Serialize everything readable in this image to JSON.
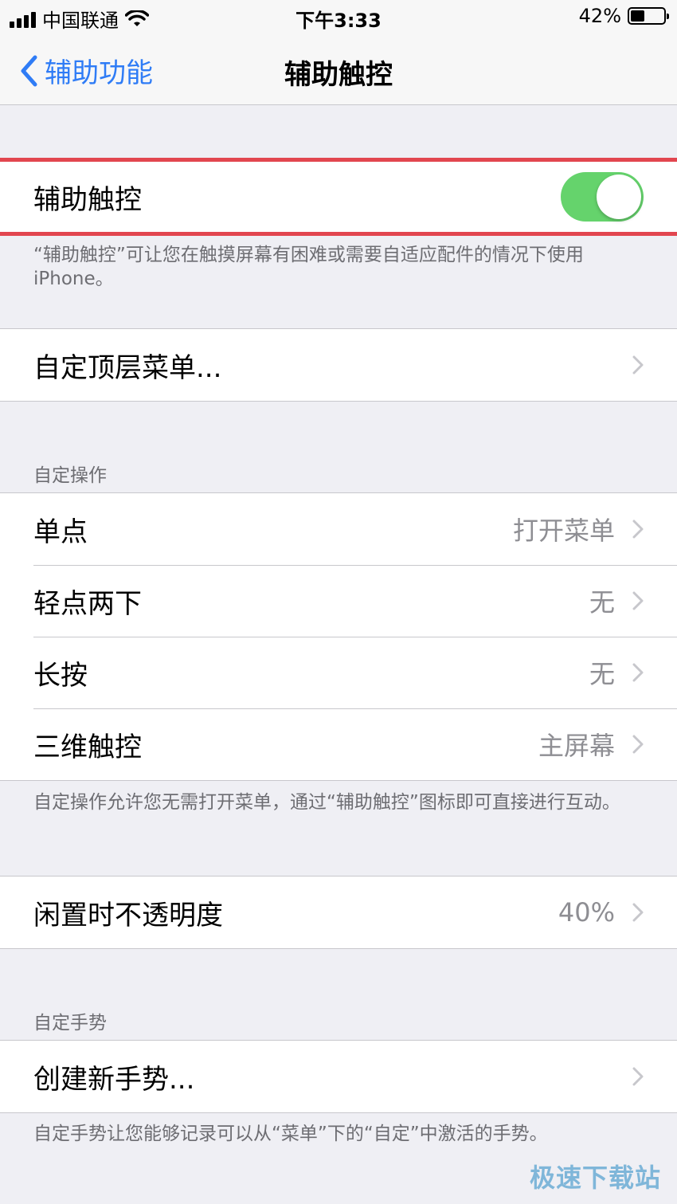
{
  "status": {
    "carrier": "中国联通",
    "time": "下午3:33",
    "battery": "42%",
    "battery_level": 0.42
  },
  "nav": {
    "back_label": "辅助功能",
    "title": "辅助触控"
  },
  "main_toggle": {
    "label": "辅助触控",
    "on": true,
    "footer": "“辅助触控”可让您在触摸屏幕有困难或需要自适应配件的情况下使用 iPhone。"
  },
  "top_menu": {
    "label": "自定顶层菜单..."
  },
  "custom_actions": {
    "header": "自定操作",
    "rows": [
      {
        "label": "单点",
        "value": "打开菜单"
      },
      {
        "label": "轻点两下",
        "value": "无"
      },
      {
        "label": "长按",
        "value": "无"
      },
      {
        "label": "三维触控",
        "value": "主屏幕"
      }
    ],
    "footer": "自定操作允许您无需打开菜单，通过“辅助触控”图标即可直接进行互动。"
  },
  "idle_opacity": {
    "label": "闲置时不透明度",
    "value": "40%"
  },
  "custom_gestures": {
    "header": "自定手势",
    "create_label": "创建新手势...",
    "footer": "自定手势让您能够记录可以从“菜单”下的“自定”中激活的手势。"
  },
  "colors": {
    "accent": "#2f7cf6",
    "toggle_on": "#65d36c",
    "highlight": "#e2464f"
  },
  "watermark": "极速下载站"
}
